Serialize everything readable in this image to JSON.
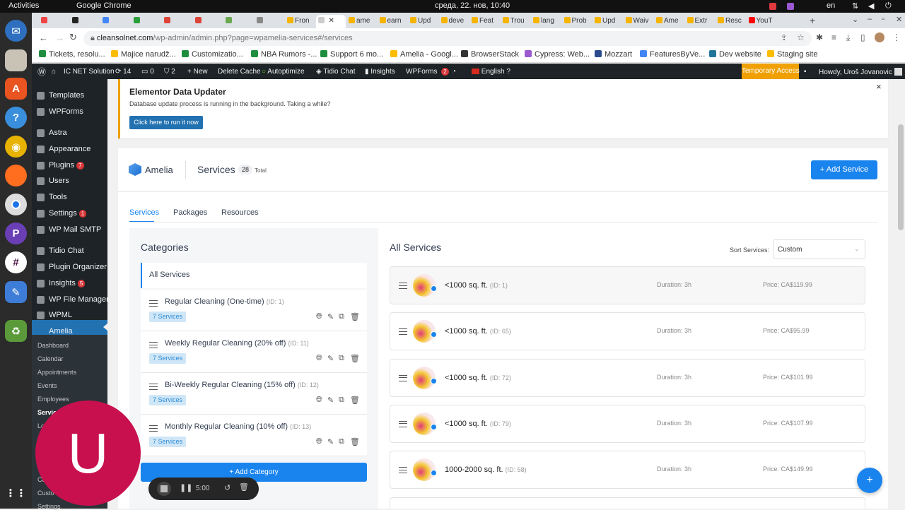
{
  "gnome": {
    "activities": "Activities",
    "app": "Google Chrome",
    "clock": "среда, 22. нов, 10:40",
    "lang": "en"
  },
  "dock": {
    "items": [
      "thunderbird-icon",
      "files-icon",
      "ubuntu-software-icon",
      "help-icon",
      "rhythmbox-icon",
      "firefox-icon",
      "chrome-icon",
      "beeper-icon",
      "slack-icon",
      "text-editor-icon",
      "trash-icon",
      "app-grid-icon"
    ]
  },
  "chrome": {
    "tabs": [
      "",
      "",
      "",
      "",
      "",
      "",
      "",
      "",
      "Fron",
      "",
      "ame",
      "earn",
      "Upd",
      "deve",
      "Feat",
      "Trou",
      "lang",
      "Prob",
      "Upd",
      "Waiv",
      "Ame",
      "Extr",
      "Resc",
      "YouT"
    ],
    "url_host": "cleansolnet.com",
    "url_path": "/wp-admin/admin.php?page=wpamelia-services#/services",
    "bookmarks": [
      "Tickets, resolu...",
      "Majice narudž...",
      "Customizatio...",
      "NBA Rumors -...",
      "Support 6 mo...",
      "Amelia - Googl...",
      "BrowserStack",
      "Cypress: Web...",
      "Mozzart",
      "FeaturesByVe...",
      "Dev website",
      "Staging site"
    ]
  },
  "adminbar": {
    "site": "IC NET Solution",
    "updates": "14",
    "comments": "0",
    "security": "2",
    "new": "New",
    "delete_cache": "Delete Cache",
    "autoptimize": "Autoptimize",
    "tidio": "Tidio Chat",
    "insights": "Insights",
    "wpforms": "WPForms",
    "wpforms_count": "2",
    "language": "English",
    "temp_access": "Temporary Access",
    "howdy": "Howdy, Uroš Jovanovic"
  },
  "sidebar": {
    "items": [
      {
        "label": "Templates",
        "badge": ""
      },
      {
        "label": "WPForms",
        "badge": ""
      },
      {
        "label": "Astra",
        "badge": ""
      },
      {
        "label": "Appearance",
        "badge": ""
      },
      {
        "label": "Plugins",
        "badge": "7"
      },
      {
        "label": "Users",
        "badge": ""
      },
      {
        "label": "Tools",
        "badge": ""
      },
      {
        "label": "Settings",
        "badge": "1"
      },
      {
        "label": "WP Mail SMTP",
        "badge": ""
      },
      {
        "label": "Tidio Chat",
        "badge": ""
      },
      {
        "label": "Plugin Organizer",
        "badge": ""
      },
      {
        "label": "Insights",
        "badge": "5"
      },
      {
        "label": "WP File Manager",
        "badge": ""
      },
      {
        "label": "WPML",
        "badge": ""
      },
      {
        "label": "Amelia",
        "badge": ""
      }
    ],
    "sub": [
      "Dashboard",
      "Calendar",
      "Appointments",
      "Events",
      "Employees",
      "Servic",
      "Lo",
      "Co",
      "Custo",
      "Settings"
    ]
  },
  "notice": {
    "title": "Elementor Data Updater",
    "text": "Database update process is running in the background. Taking a while?",
    "button": "Click here to run it now",
    "close": "×"
  },
  "header": {
    "brand": "Amelia",
    "title": "Services",
    "count": "28",
    "count_label": "Total",
    "add_button": "Add Service"
  },
  "tabs": [
    "Services",
    "Packages",
    "Resources"
  ],
  "categories": {
    "heading": "Categories",
    "all": "All Services",
    "add_button": "Add Category",
    "items": [
      {
        "name": "Regular Cleaning (One-time)",
        "id": "(ID: 1)",
        "tag": "7 Services"
      },
      {
        "name": "Weekly Regular Cleaning (20% off)",
        "id": "(ID: 11)",
        "tag": "7 Services"
      },
      {
        "name": "Bi-Weekly Regular Cleaning (15% off)",
        "id": "(ID: 12)",
        "tag": "7 Services"
      },
      {
        "name": "Monthly Regular Cleaning (10% off)",
        "id": "(ID: 13)",
        "tag": "7 Services"
      }
    ]
  },
  "services": {
    "heading": "All Services",
    "sort_label": "Sort Services:",
    "sort_value": "Custom",
    "items": [
      {
        "name": "<1000 sq. ft.",
        "id": "(ID: 1)",
        "duration": "Duration: 3h",
        "price": "Price: CA$119.99"
      },
      {
        "name": "<1000 sq. ft.",
        "id": "(ID: 65)",
        "duration": "Duration: 3h",
        "price": "Price: CA$95.99"
      },
      {
        "name": "<1000 sq. ft.",
        "id": "(ID: 72)",
        "duration": "Duration: 3h",
        "price": "Price: CA$101.99"
      },
      {
        "name": "<1000 sq. ft.",
        "id": "(ID: 79)",
        "duration": "Duration: 3h",
        "price": "Price: CA$107.99"
      },
      {
        "name": "1000-2000 sq. ft.",
        "id": "(ID: 58)",
        "duration": "Duration: 3h",
        "price": "Price: CA$149.99"
      }
    ]
  },
  "recorder": {
    "letter": "U",
    "time": "5:00"
  },
  "colors": {
    "primary": "#1a84ee",
    "wp_dark": "#1d2327",
    "notice_accent": "#f0a000",
    "recorder": "#c8104f"
  }
}
